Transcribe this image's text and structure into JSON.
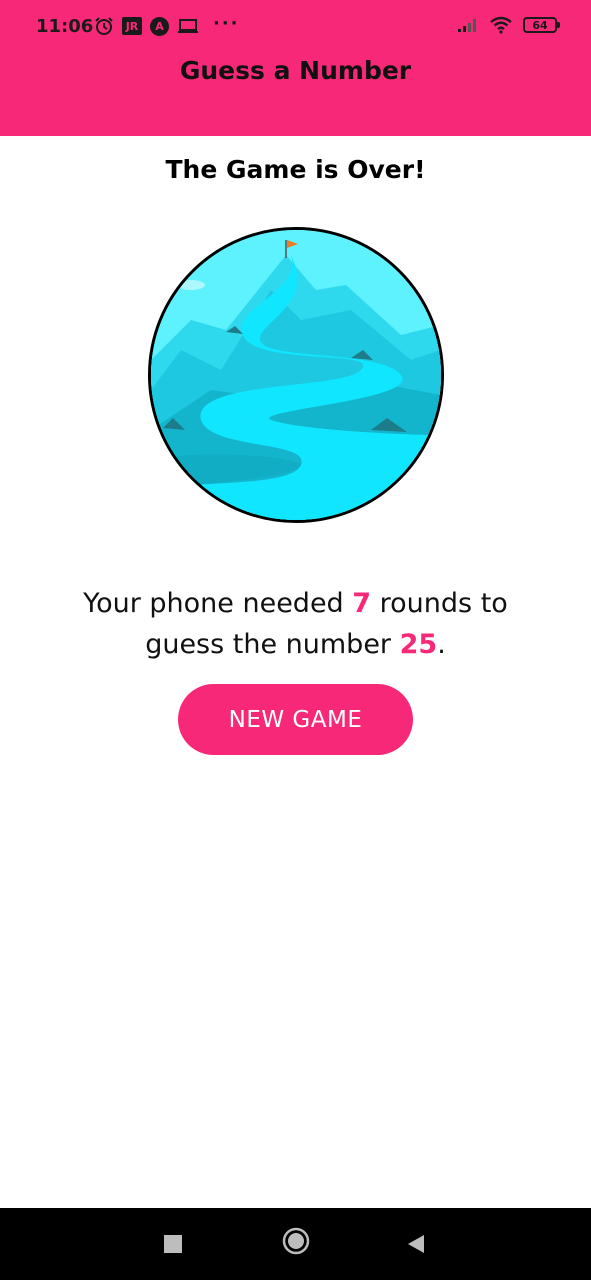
{
  "status_bar": {
    "time": "11:06",
    "left_icons": [
      "alarm-icon",
      "jr-app-icon",
      "a-app-icon",
      "laptop-icon",
      "more-icon"
    ],
    "jr_label": "JR",
    "a_label": "A",
    "more_label": "···",
    "battery_level": "64",
    "right_icons": [
      "signal-icon",
      "wifi-icon",
      "battery-icon"
    ]
  },
  "app_bar": {
    "title": "Guess a Number",
    "color": "#f72877"
  },
  "game_over": {
    "title": "The Game is Over!",
    "image_icon": "mountain-path-illustration",
    "summary_prefix": "Your phone needed ",
    "rounds": "7",
    "summary_middle": " rounds to guess the number ",
    "number": "25",
    "summary_suffix": ".",
    "new_game_label": "NEW GAME",
    "accent_color": "#f72877"
  },
  "nav_bar": {
    "buttons": [
      "recents-square-icon",
      "home-circle-icon",
      "back-triangle-icon"
    ]
  }
}
